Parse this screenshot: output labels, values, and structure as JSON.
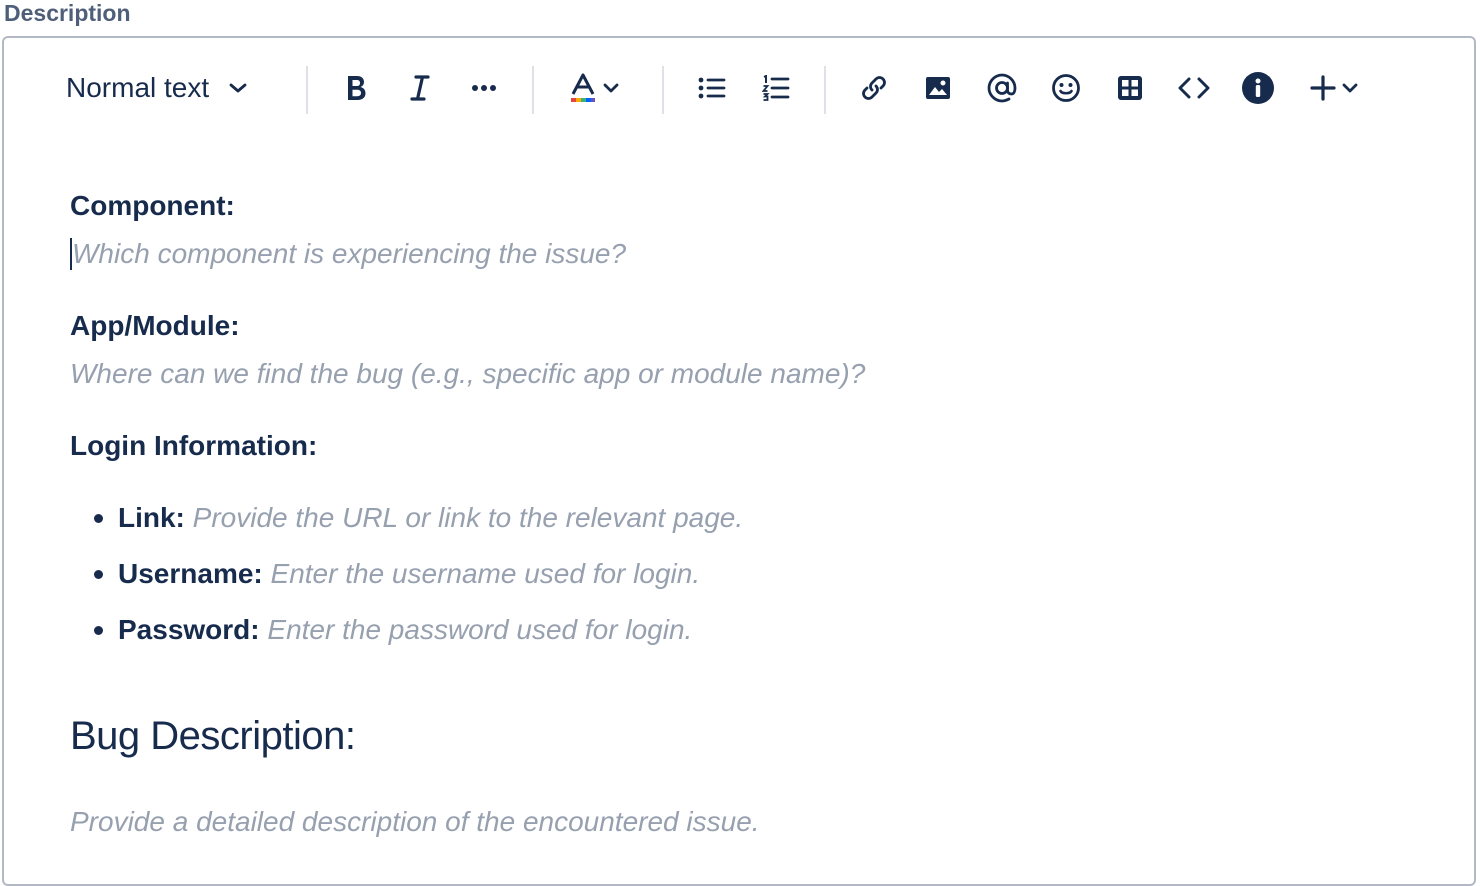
{
  "field": {
    "label": "Description"
  },
  "toolbar": {
    "text_style": "Normal text",
    "buttons": [
      "bold-icon",
      "italic-icon",
      "more-formatting-icon",
      "text-color-icon",
      "bullet-list-icon",
      "numbered-list-icon",
      "link-icon",
      "image-icon",
      "mention-icon",
      "emoji-icon",
      "table-icon",
      "code-icon",
      "info-icon",
      "insert-plus-icon"
    ],
    "text_color_bar": [
      "#e2483d",
      "#ffab00",
      "#36b37e",
      "#0065ff",
      "#6554c0"
    ]
  },
  "content": {
    "component_label": "Component:",
    "component_placeholder": "Which component is experiencing the issue?",
    "module_label": "App/Module:",
    "module_placeholder": "Where can we find the bug (e.g., specific app or module name)?",
    "login_label": "Login Information:",
    "login_items": [
      {
        "label": "Link:",
        "hint": "Provide the URL or link to the relevant page."
      },
      {
        "label": "Username:",
        "hint": "Enter the username used for login."
      },
      {
        "label": "Password:",
        "hint": "Enter the password used for login."
      }
    ],
    "bug_heading": "Bug Description:",
    "bug_placeholder": "Provide a detailed description of the encountered issue."
  }
}
